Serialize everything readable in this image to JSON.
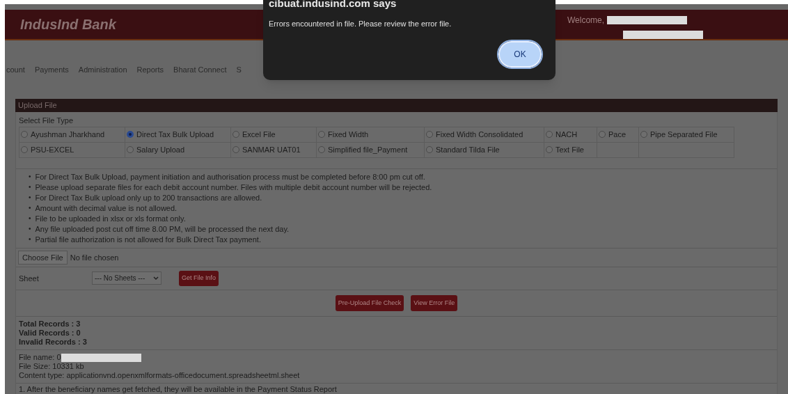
{
  "header": {
    "logo": "IndusInd Bank",
    "welcome": "Welcome,"
  },
  "nav": [
    "count",
    "Payments",
    "Administration",
    "Reports",
    "Bharat Connect",
    "S"
  ],
  "dialog": {
    "title": "cibuat.indusind.com says",
    "message": "Errors encountered in file. Please review the error file.",
    "button": "OK"
  },
  "panel": {
    "title": "Upload File",
    "file_type_label": "Select File Type",
    "file_types": [
      [
        {
          "label": "Ayushman Jharkhand",
          "selected": false
        },
        {
          "label": "Direct Tax Bulk Upload",
          "selected": true
        },
        {
          "label": "Excel File",
          "selected": false
        },
        {
          "label": "Fixed Width",
          "selected": false
        },
        {
          "label": "Fixed Width Consolidated",
          "selected": false
        },
        {
          "label": "NACH",
          "selected": false
        },
        {
          "label": "Pace",
          "selected": false
        },
        {
          "label": "Pipe Separated File",
          "selected": false
        }
      ],
      [
        {
          "label": "PSU-EXCEL",
          "selected": false
        },
        {
          "label": "Salary Upload",
          "selected": false
        },
        {
          "label": "SANMAR UAT01",
          "selected": false
        },
        {
          "label": "Simplified file_Payment",
          "selected": false
        },
        {
          "label": "Standard Tilda File",
          "selected": false
        },
        {
          "label": "Text File",
          "selected": false
        }
      ]
    ],
    "bullet": "•",
    "notes": [
      "For Direct Tax Bulk Upload, payment initiation and authorisation process must be completed before 8:00 pm cut off.",
      "Please upload separate files for each debit account number. Files with multiple debit account number will be rejected.",
      "For Direct Tax Bulk upload only up to 200 transactions are allowed.",
      "Amount with decimal value is not allowed.",
      "File to be uploaded in xlsx or xls format only.",
      "Any file uploaded post cut off time 8.00 PM, will be processed the next day.",
      "Partial file authorization is not allowed for Bulk Direct Tax payment."
    ],
    "choose_file": "Choose File",
    "file_status": "No file chosen",
    "sheet_label": "Sheet",
    "sheet_value": "--- No Sheets ---",
    "get_info": "Get File Info",
    "actions": [
      "Pre-Upload File Check",
      "View Error File"
    ],
    "records": [
      "Total Records : 3",
      "Valid Records : 0",
      "Invalid Records : 3"
    ],
    "file_info": [
      "File name: 0",
      "File Size: 10331 kb",
      "Content type: applicationvnd.openxmlformats-officedocument.spreadsheetml.sheet"
    ],
    "footnote": "1. After the beneficiary names get fetched, they will be available in the Payment Status Report"
  }
}
